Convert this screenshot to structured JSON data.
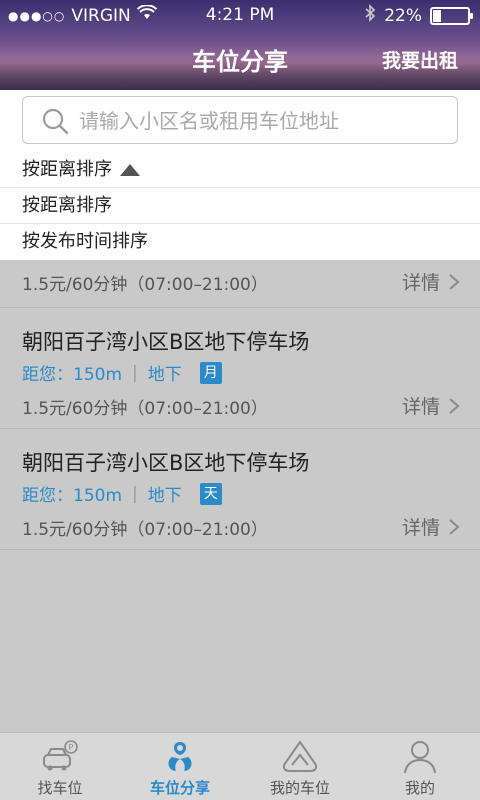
{
  "status_bar": {
    "signal": "●●●○○",
    "carrier": "VIRGIN",
    "time": "4:21 PM",
    "battery": "22%",
    "battery_level": 0.22
  },
  "nav": {
    "title": "车位分享",
    "right_action": "我要出租"
  },
  "search": {
    "placeholder": "请输入小区名或租用车位地址",
    "value": ""
  },
  "sort": {
    "selected": "按距离排序",
    "options": [
      "按距离排序",
      "按发布时间排序"
    ]
  },
  "list": {
    "partial_item": {
      "price": "1.5元/60分钟（07:00–21:00）",
      "detail": "详情"
    },
    "items": [
      {
        "title": "朝阳百子湾小区B区地下停车场",
        "distance": "距您：150m",
        "separator": "|",
        "location": "地下",
        "badge": "月",
        "price": "1.5元/60分钟（07:00–21:00）",
        "detail": "详情"
      },
      {
        "title": "朝阳百子湾小区B区地下停车场",
        "distance": "距您：150m",
        "separator": "|",
        "location": "地下",
        "badge": "天",
        "price": "1.5元/60分钟（07:00–21:00）",
        "detail": "详情"
      }
    ]
  },
  "tabbar": {
    "tabs": [
      {
        "label": "找车位",
        "icon": "car-parking-icon",
        "active": false
      },
      {
        "label": "车位分享",
        "icon": "share-icon",
        "active": true
      },
      {
        "label": "我的车位",
        "icon": "my-parking-icon",
        "active": false
      },
      {
        "label": "我的",
        "icon": "user-icon",
        "active": false
      }
    ]
  },
  "colors": {
    "accent": "#2a8bc8",
    "background": "#c9c9c9"
  }
}
